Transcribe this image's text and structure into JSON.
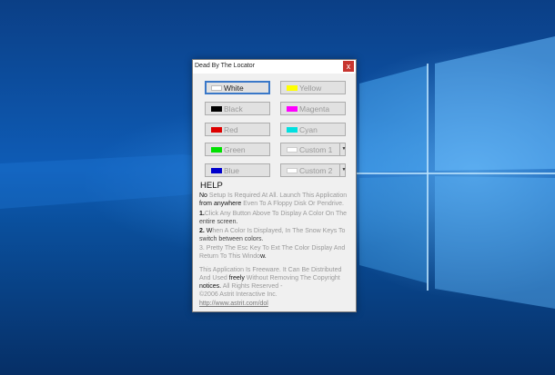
{
  "window": {
    "title": "Dead By The Locator",
    "close_glyph": "x"
  },
  "buttons": [
    {
      "label": "White",
      "swatch": "#ffffff",
      "selected": true
    },
    {
      "label": "Yellow",
      "swatch": "#ffff00"
    },
    {
      "label": "Black",
      "swatch": "#000000"
    },
    {
      "label": "Magenta",
      "swatch": "#ff00ff"
    },
    {
      "label": "Red",
      "swatch": "#dd0000"
    },
    {
      "label": "Cyan",
      "swatch": "#00e0e0"
    },
    {
      "label": "Green",
      "swatch": "#00e000"
    },
    {
      "label": "Custom 1",
      "swatch": "#ffffff"
    },
    {
      "label": "Blue",
      "swatch": "#0000cc"
    },
    {
      "label": "Custom 2",
      "swatch": "#ffffff"
    }
  ],
  "help": {
    "title": "HELP",
    "p1_a": "No",
    "p1_b": "Setup Is Required At All. Launch This Application",
    "p1_c": "from anywhere",
    "p1_d": "Even To A Floppy Disk Or Pendrive.",
    "p2_a": "1.",
    "p2_b": "Click Any Button Above To Display A Color On The",
    "p2_c": "entire screen.",
    "p3_a": "2.",
    "p3_b": "W",
    "p3_c": "hen A Color Is Displayed, In The Snow Keys To",
    "p3_d": "switch between colors.",
    "p4_a": "3. Pretty The Esc Key To Ext The Color Display And",
    "p4_b": "Return To This Windo",
    "p4_c": "w.",
    "p5_a": "This Application Is Freeware. It Can Be Distributed",
    "p5_b": "And Used",
    "p5_c": "freely",
    "p5_d": "Without Removing The Copyright",
    "p5_e": "notices.",
    "p5_f": "All Rights Reserved -",
    "p5_g": "©2006 Astrit Interactive Inc.",
    "link": "http://www.astrit.com/dol"
  },
  "colors": {
    "desktop": "#0a4f9c",
    "selection": "#3a78c8",
    "close": "#c7352f"
  }
}
